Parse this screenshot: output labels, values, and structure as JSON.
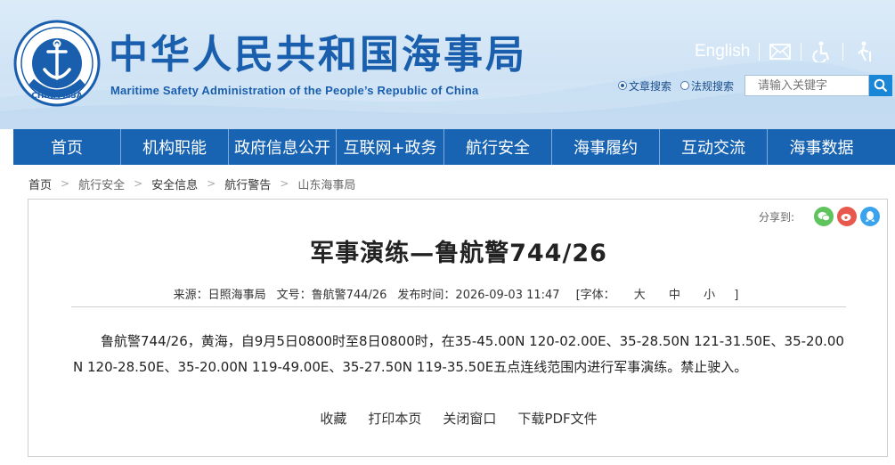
{
  "header": {
    "title": "中华人民共和国海事局",
    "subtitle": "Maritime Safety Administration of the People’s Republic of China",
    "logo_text": "CHINA MSA",
    "english_link": "English",
    "icons": [
      "mail-icon",
      "accessibility-icon",
      "elderly-mode-icon"
    ],
    "brand_color": "#1a5fae"
  },
  "search": {
    "options": [
      "文章搜索",
      "法规搜索"
    ],
    "selected": "文章搜索",
    "placeholder": "请输入关键字"
  },
  "nav": {
    "items": [
      "首页",
      "机构职能",
      "政府信息公开",
      "互联网+政务",
      "航行安全",
      "海事履约",
      "互动交流",
      "海事数据"
    ],
    "background": "#1864b3"
  },
  "breadcrumb": [
    "首页",
    "航行安全",
    "安全信息",
    "航行警告",
    "山东海事局"
  ],
  "share": {
    "label": "分享到:",
    "targets": [
      "wechat-icon",
      "weibo-icon",
      "qq-icon"
    ]
  },
  "article": {
    "title": "军事演练—鲁航警744/26",
    "source": "来源：日照海事局",
    "doc_no": "文号：鲁航警744/26",
    "publish_time": "发布时间：2026-09-03 11:47",
    "font_size_label": "[字体：",
    "font_sizes": [
      "大",
      "中",
      "小"
    ],
    "font_size_close": "]",
    "body": "鲁航警744/26，黄海，自9月5日0800时至8日0800时，在35-45.00N 120-02.00E、35-28.50N 121-31.50E、35-20.00N 120-28.50E、35-20.00N 119-49.00E、35-27.50N 119-35.50E五点连线范围内进行军事演练。禁止驶入。"
  },
  "actions": [
    "收藏",
    "打印本页",
    "关闭窗口",
    "下载PDF文件"
  ]
}
